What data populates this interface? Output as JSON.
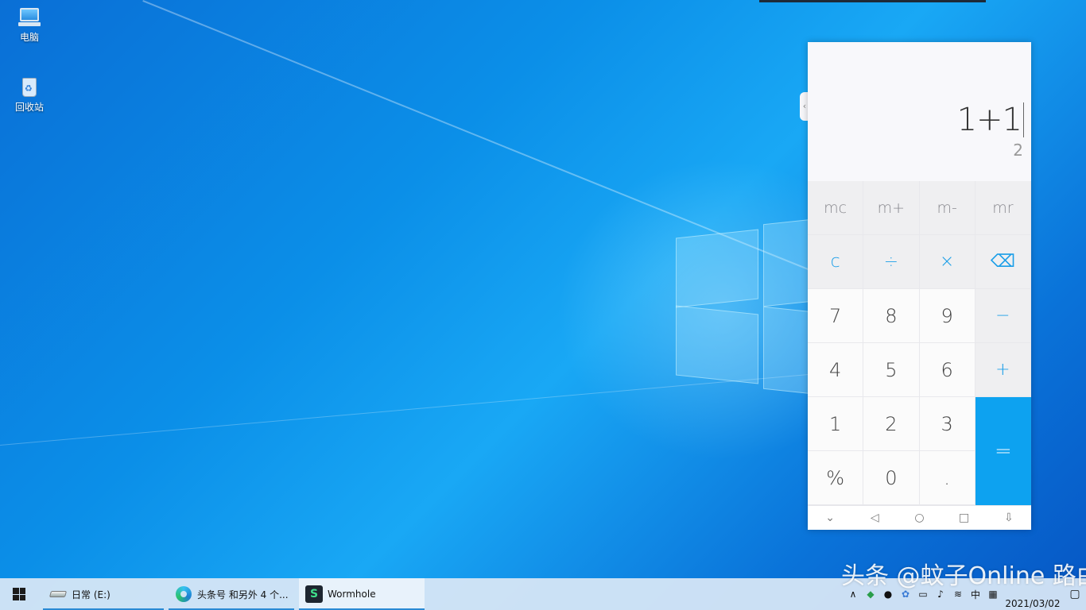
{
  "desktop": {
    "icons": [
      {
        "label": "电脑"
      },
      {
        "label": "回收站"
      }
    ]
  },
  "calculator": {
    "expression": "1+1",
    "result": "2",
    "tab_glyph": "‹",
    "memory_keys": [
      "mc",
      "m+",
      "m-",
      "mr"
    ],
    "row_ops": [
      "c",
      "÷",
      "×",
      "⌫"
    ],
    "digits_row1": [
      "7",
      "8",
      "9"
    ],
    "minus": "−",
    "digits_row2": [
      "4",
      "5",
      "6"
    ],
    "plus": "+",
    "digits_row3": [
      "1",
      "2",
      "3"
    ],
    "equals": "=",
    "bottom_row": [
      "%",
      "0",
      "."
    ],
    "nav": [
      "⌄",
      "◁",
      "○",
      "□",
      "⇩"
    ]
  },
  "taskbar": {
    "items": [
      {
        "label": "日常 (E:)",
        "icon": "drive-icon"
      },
      {
        "label": "头条号 和另外 4 个...",
        "icon": "edge-icon"
      },
      {
        "label": "Wormhole",
        "icon": "wormhole-icon"
      }
    ],
    "tray": {
      "chevron": "∧",
      "ime": "中",
      "date": "2021/03/02",
      "icons": [
        "shield-icon",
        "qq-icon",
        "network-share-icon",
        "battery-icon",
        "volume-icon",
        "wifi-icon"
      ]
    }
  },
  "watermark": "头条 @蚊子Online  路由器"
}
